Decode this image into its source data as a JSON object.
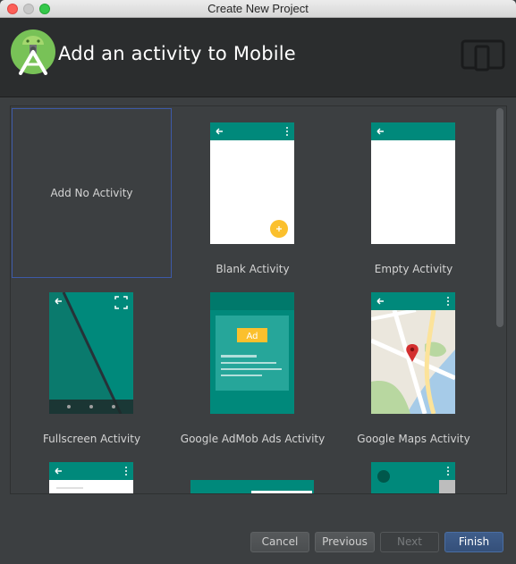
{
  "window": {
    "title": "Create New Project"
  },
  "header": {
    "title": "Add an activity to Mobile",
    "device_icon": "phone-tablet-icon",
    "logo_icon": "android-studio-logo"
  },
  "gallery": {
    "tiles": [
      {
        "label": "Add No Activity",
        "selected": true
      },
      {
        "label": "Blank Activity"
      },
      {
        "label": "Empty Activity"
      },
      {
        "label": "Fullscreen Activity"
      },
      {
        "label": "Google AdMob Ads Activity",
        "badge": "Ad"
      },
      {
        "label": "Google Maps Activity"
      }
    ]
  },
  "buttons": {
    "cancel": "Cancel",
    "previous": "Previous",
    "next": "Next",
    "finish": "Finish"
  },
  "colors": {
    "material_teal": "#00897b",
    "fab_yellow": "#fbc02d",
    "selection": "#3d5aa8"
  }
}
